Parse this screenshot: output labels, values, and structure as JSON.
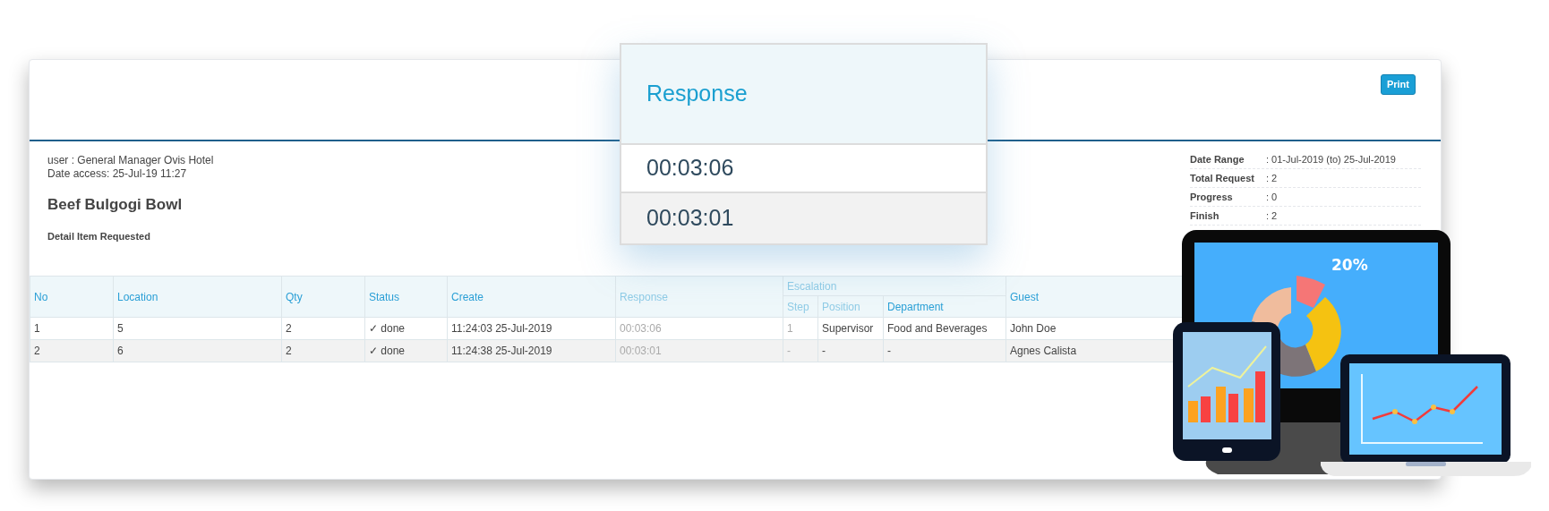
{
  "header": {
    "print_button": "Print"
  },
  "info": {
    "user": "user : General Manager Ovis Hotel",
    "date_access": "Date access: 25-Jul-19 11:27",
    "item_title": "Beef Bulgogi Bowl",
    "subtitle": "Detail Item Requested"
  },
  "summary": [
    {
      "label": "Date Range",
      "value": ": 01-Jul-2019 (to) 25-Jul-2019"
    },
    {
      "label": "Total Request",
      "value": ": 2"
    },
    {
      "label": "Progress",
      "value": ": 0"
    },
    {
      "label": "Finish",
      "value": ": 2"
    }
  ],
  "table": {
    "columns": [
      "No",
      "Location",
      "Qty",
      "Status",
      "Create",
      "Response"
    ],
    "group": {
      "label": "Escalation",
      "columns": [
        "Step",
        "Position",
        "Department"
      ]
    },
    "trailing_columns": [
      "Guest"
    ],
    "rows": [
      [
        "1",
        "5",
        "2",
        "✓ done",
        "11:24:03 25-Jul-2019",
        "00:03:06",
        "1",
        "Supervisor",
        "Food and Beverages",
        "John Doe"
      ],
      [
        "2",
        "6",
        "2",
        "✓ done",
        "11:24:38 25-Jul-2019",
        "00:03:01",
        "-",
        "-",
        "-",
        "Agnes Calista"
      ]
    ]
  },
  "response_callout": {
    "title": "Response",
    "values": [
      "00:03:06",
      "00:03:01"
    ]
  },
  "devices_illustration": {
    "monitor_label": "20%"
  }
}
